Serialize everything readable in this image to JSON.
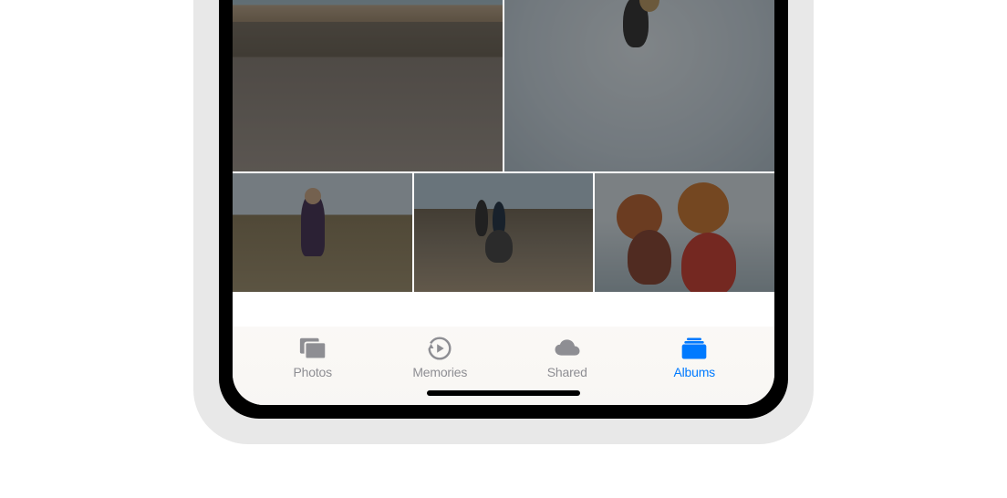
{
  "tabbar": {
    "items": [
      {
        "label": "Photos",
        "icon": "photos-icon",
        "active": false
      },
      {
        "label": "Memories",
        "icon": "memories-icon",
        "active": false
      },
      {
        "label": "Shared",
        "icon": "shared-icon",
        "active": false
      },
      {
        "label": "Albums",
        "icon": "albums-icon",
        "active": true
      }
    ]
  },
  "colors": {
    "active": "#007aff",
    "inactive": "#8e8e93"
  }
}
